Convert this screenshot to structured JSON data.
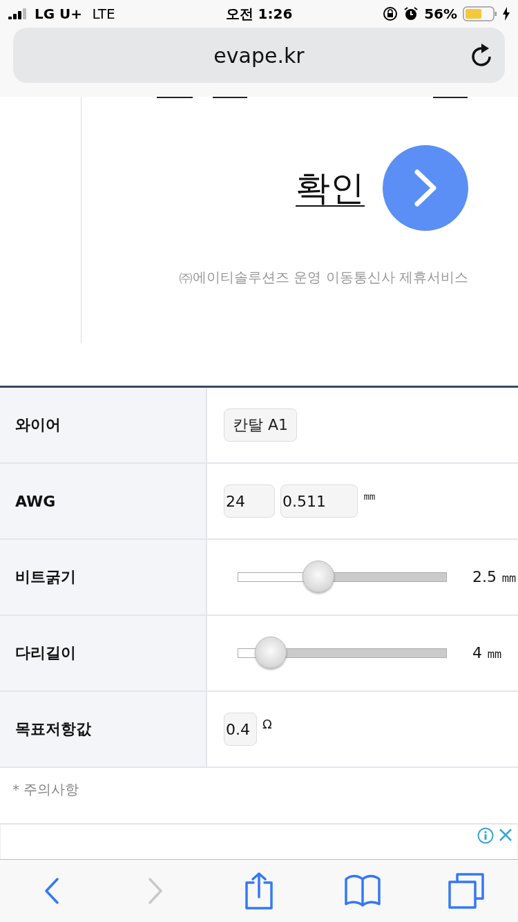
{
  "status_bar": {
    "carrier": "LG U+",
    "network": "LTE",
    "time": "오전 1:26",
    "battery": "56%"
  },
  "address_bar": {
    "url": "evape.kr"
  },
  "hero": {
    "confirm_label": "확인",
    "caption": "㈜에이티솔루션즈 운영 이동통신사 제휴서비스"
  },
  "table": {
    "rows": [
      {
        "label": "와이어",
        "kind": "select",
        "value": "칸탈 A1"
      },
      {
        "label": "AWG",
        "kind": "inputs",
        "values": [
          "24",
          "0.511"
        ],
        "unit": "㎜"
      },
      {
        "label": "비트굵기",
        "kind": "slider",
        "level": 0.386,
        "reading": "2.5 ㎜"
      },
      {
        "label": "다리길이",
        "kind": "slider",
        "level": 0.155,
        "reading": "4 ㎜"
      },
      {
        "label": "목표저항값",
        "kind": "inputs",
        "values": [
          "0.4"
        ],
        "unit": "Ω"
      }
    ]
  },
  "note": "* 주의사항",
  "toolbar": {
    "buttons": [
      {
        "kind": "back",
        "disabled": false
      },
      {
        "kind": "forward",
        "disabled": true
      },
      {
        "kind": "share",
        "disabled": false
      },
      {
        "kind": "bookmarks",
        "disabled": false
      },
      {
        "kind": "tabs",
        "disabled": false
      }
    ]
  }
}
